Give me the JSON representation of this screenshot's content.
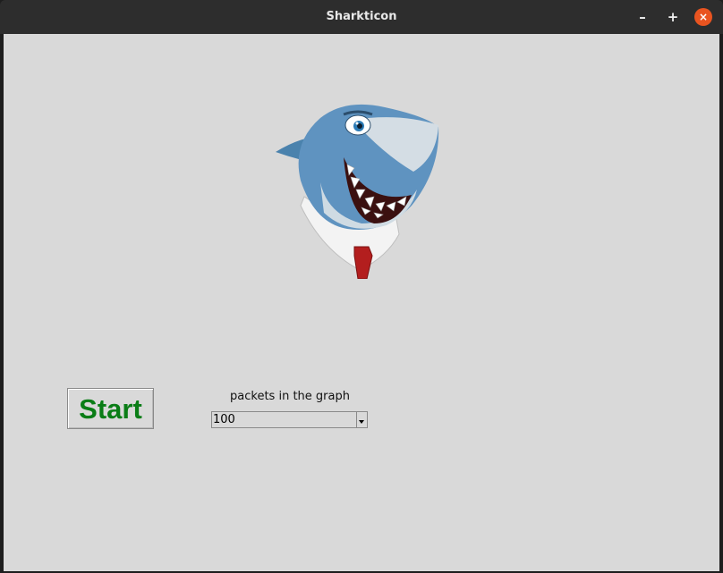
{
  "window": {
    "title": "Sharkticon"
  },
  "controls": {
    "minimize": "–",
    "maximize": "+",
    "close": "×"
  },
  "main": {
    "start_label": "Start",
    "graph_label": "packets in the graph",
    "combo_value": "100"
  },
  "colors": {
    "start_text": "#0a7d16",
    "close_button": "#e95420",
    "background": "#d9d9d9"
  },
  "icons": [
    "shark-mascot-icon",
    "minimize-icon",
    "maximize-icon",
    "close-icon",
    "dropdown-arrow-icon"
  ]
}
